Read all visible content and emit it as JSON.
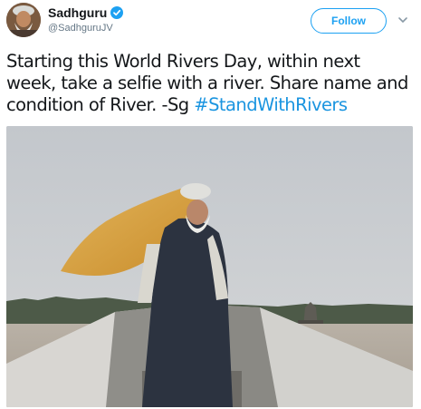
{
  "author": {
    "display_name": "Sadhguru",
    "handle": "@SadhguruJV",
    "verified": true,
    "avatar_icon": "person-avatar"
  },
  "actions": {
    "follow_label": "Follow",
    "more_icon": "chevron-down-icon"
  },
  "tweet": {
    "text": "Starting this World Rivers Day, within next week, take a selfie with a river. Share name and condition of River. -Sg ",
    "hashtag": "#StandWithRivers"
  },
  "media": {
    "type": "photo",
    "subject": "man in boat on river with flowing yellow scarf"
  },
  "colors": {
    "accent": "#1da1f2",
    "link": "#1b95e0",
    "text": "#14171a",
    "secondary": "#657786"
  }
}
